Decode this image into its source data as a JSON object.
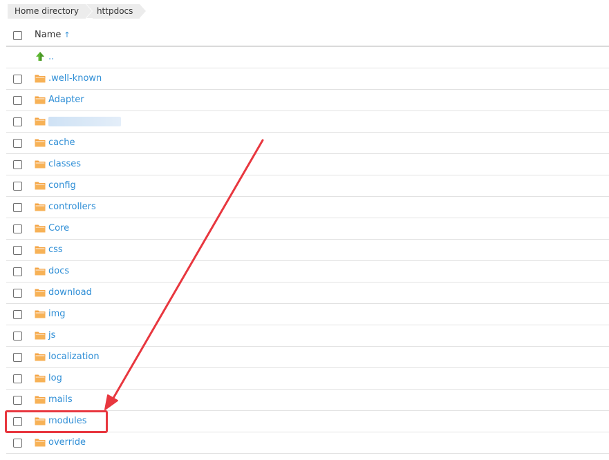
{
  "breadcrumb": {
    "items": [
      "Home directory",
      "httpdocs"
    ]
  },
  "table": {
    "name_header": "Name",
    "sort_indicator": "↑",
    "parent_label": "..",
    "rows": [
      {
        "name": ".well-known"
      },
      {
        "name": "Adapter"
      },
      {
        "name": "",
        "redacted": true
      },
      {
        "name": "cache"
      },
      {
        "name": "classes"
      },
      {
        "name": "config"
      },
      {
        "name": "controllers"
      },
      {
        "name": "Core"
      },
      {
        "name": "css"
      },
      {
        "name": "docs"
      },
      {
        "name": "download"
      },
      {
        "name": "img"
      },
      {
        "name": "js"
      },
      {
        "name": "localization"
      },
      {
        "name": "log"
      },
      {
        "name": "mails"
      },
      {
        "name": "modules",
        "highlighted": true
      },
      {
        "name": "override"
      }
    ]
  },
  "icons": {
    "folder": "folder-icon",
    "parent": "up-arrow-icon",
    "sort": "sort-ascending-icon"
  },
  "colors": {
    "link": "#2e8ed6",
    "folder": "#f5a646",
    "annotation": "#e8373f",
    "up_arrow": "#5cb531"
  }
}
